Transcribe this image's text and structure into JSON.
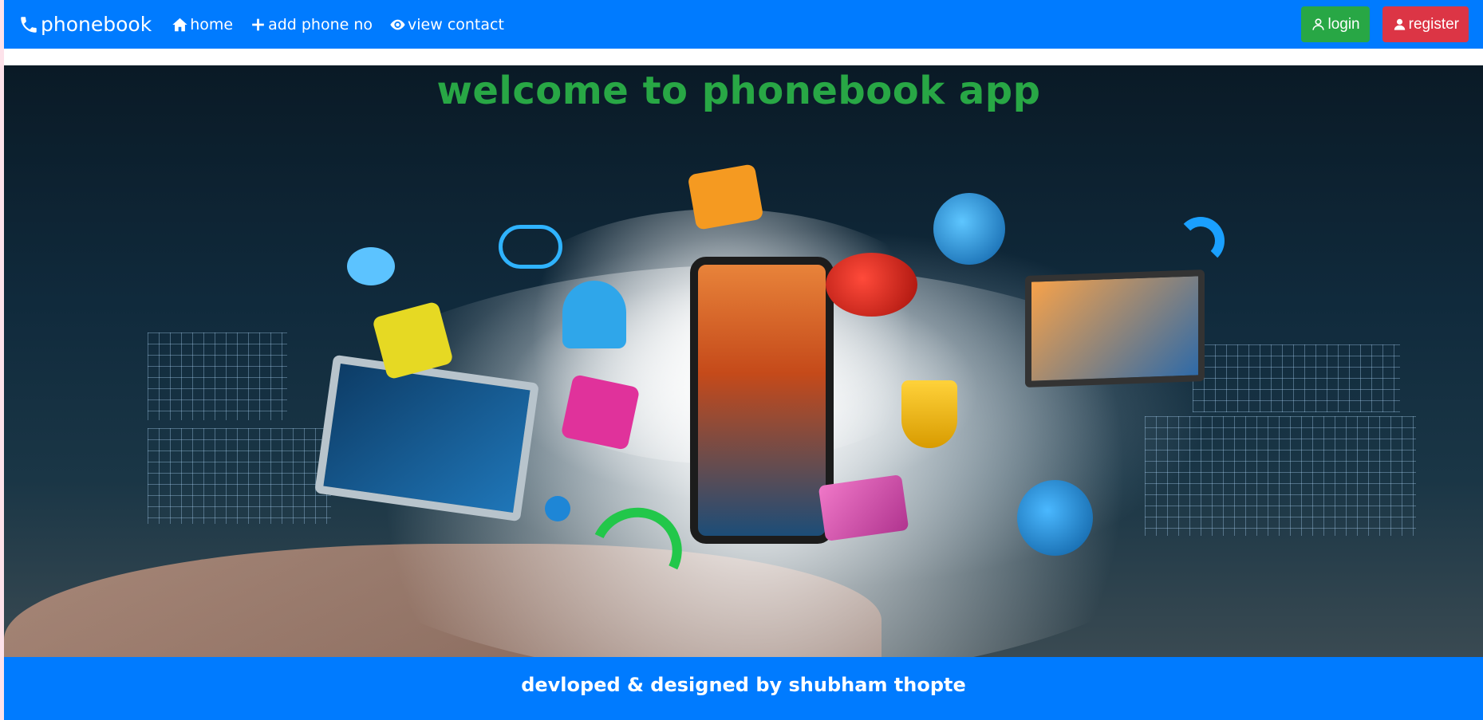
{
  "navbar": {
    "brand": "phonebook",
    "links": [
      {
        "label": "home",
        "icon": "home-icon"
      },
      {
        "label": "add phone no",
        "icon": "plus-icon"
      },
      {
        "label": "view contact",
        "icon": "eye-icon"
      }
    ],
    "login_label": "login",
    "register_label": "register"
  },
  "hero": {
    "title": "welcome to phonebook app"
  },
  "footer": {
    "text": "devloped & designed by shubham thopte"
  },
  "colors": {
    "navbar": "#007bff",
    "title": "#28a745",
    "login_button": "#28a745",
    "register_button": "#dc3545"
  }
}
